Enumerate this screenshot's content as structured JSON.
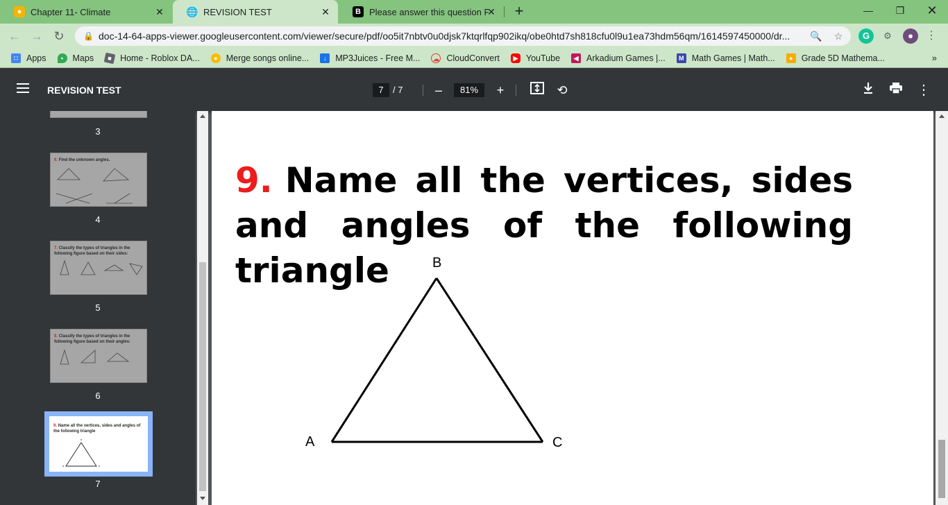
{
  "tabs": [
    {
      "title": "Chapter 11- Climate",
      "icon": "google-classroom-icon",
      "active": false
    },
    {
      "title": "REVISION TEST",
      "icon": "globe-icon",
      "active": true
    },
    {
      "title": "Please answer this question PLEA",
      "icon": "brainly-icon",
      "active": false
    }
  ],
  "address": {
    "url": "doc-14-64-apps-viewer.googleusercontent.com/viewer/secure/pdf/oo5it7nbtv0u0djsk7ktqrlfqp902ikq/obe0htd7sh818cfu0l9u1ea73hdm56qm/1614597450000/dr..."
  },
  "bookmarks": [
    {
      "label": "Apps",
      "icon": "apps-grid-icon",
      "color": "#4285f4"
    },
    {
      "label": "Maps",
      "icon": "maps-pin-icon",
      "color": "#34a853"
    },
    {
      "label": "Home - Roblox DA...",
      "icon": "roblox-icon",
      "color": "#5f6368"
    },
    {
      "label": "Merge songs online...",
      "icon": "merge-icon",
      "color": "#fbbc04"
    },
    {
      "label": "MP3Juices - Free M...",
      "icon": "download-icon",
      "color": "#1a73e8"
    },
    {
      "label": "CloudConvert",
      "icon": "cloud-icon",
      "color": "#e53935"
    },
    {
      "label": "YouTube",
      "icon": "youtube-icon",
      "color": "#ff0000"
    },
    {
      "label": "Arkadium Games |...",
      "icon": "arkadium-icon",
      "color": "#c2185b"
    },
    {
      "label": "Math Games | Math...",
      "icon": "math-games-icon",
      "color": "#3949ab"
    },
    {
      "label": "Grade 5D Mathema...",
      "icon": "classroom-icon",
      "color": "#f9ab00"
    }
  ],
  "pdf": {
    "title": "REVISION TEST",
    "current_page": "7",
    "total_pages": "/  7",
    "zoom": "81%"
  },
  "thumbnails": [
    {
      "page": "3"
    },
    {
      "page": "4",
      "num": "6.",
      "text": "Find the unknown angles."
    },
    {
      "page": "5",
      "num": "7.",
      "text": "Classify the types of triangles in the following figure based on their sides:"
    },
    {
      "page": "6",
      "num": "8.",
      "text": "Classify the types of triangles in the following figure based on their angles:"
    },
    {
      "page": "7",
      "num": "9.",
      "text": "Name all the vertices, sides and angles of the following triangle",
      "current": true
    }
  ],
  "content": {
    "question_number": "9.",
    "question_text": "Name all the vertices, sides and angles of the following triangle",
    "vertices": {
      "top": "B",
      "left": "A",
      "right": "C"
    }
  }
}
